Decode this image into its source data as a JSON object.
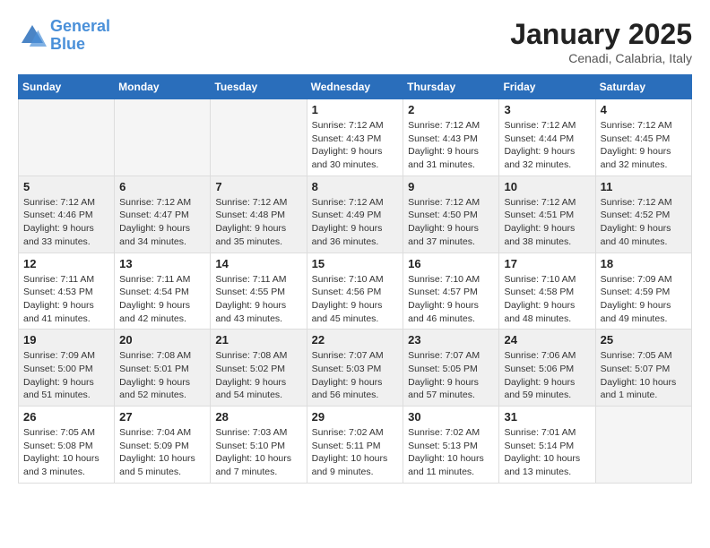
{
  "logo": {
    "name_line1": "General",
    "name_line2": "Blue"
  },
  "header": {
    "month": "January 2025",
    "location": "Cenadi, Calabria, Italy"
  },
  "weekdays": [
    "Sunday",
    "Monday",
    "Tuesday",
    "Wednesday",
    "Thursday",
    "Friday",
    "Saturday"
  ],
  "weeks": [
    {
      "shaded": false,
      "days": [
        {
          "num": "",
          "info": ""
        },
        {
          "num": "",
          "info": ""
        },
        {
          "num": "",
          "info": ""
        },
        {
          "num": "1",
          "info": "Sunrise: 7:12 AM\nSunset: 4:43 PM\nDaylight: 9 hours\nand 30 minutes."
        },
        {
          "num": "2",
          "info": "Sunrise: 7:12 AM\nSunset: 4:43 PM\nDaylight: 9 hours\nand 31 minutes."
        },
        {
          "num": "3",
          "info": "Sunrise: 7:12 AM\nSunset: 4:44 PM\nDaylight: 9 hours\nand 32 minutes."
        },
        {
          "num": "4",
          "info": "Sunrise: 7:12 AM\nSunset: 4:45 PM\nDaylight: 9 hours\nand 32 minutes."
        }
      ]
    },
    {
      "shaded": true,
      "days": [
        {
          "num": "5",
          "info": "Sunrise: 7:12 AM\nSunset: 4:46 PM\nDaylight: 9 hours\nand 33 minutes."
        },
        {
          "num": "6",
          "info": "Sunrise: 7:12 AM\nSunset: 4:47 PM\nDaylight: 9 hours\nand 34 minutes."
        },
        {
          "num": "7",
          "info": "Sunrise: 7:12 AM\nSunset: 4:48 PM\nDaylight: 9 hours\nand 35 minutes."
        },
        {
          "num": "8",
          "info": "Sunrise: 7:12 AM\nSunset: 4:49 PM\nDaylight: 9 hours\nand 36 minutes."
        },
        {
          "num": "9",
          "info": "Sunrise: 7:12 AM\nSunset: 4:50 PM\nDaylight: 9 hours\nand 37 minutes."
        },
        {
          "num": "10",
          "info": "Sunrise: 7:12 AM\nSunset: 4:51 PM\nDaylight: 9 hours\nand 38 minutes."
        },
        {
          "num": "11",
          "info": "Sunrise: 7:12 AM\nSunset: 4:52 PM\nDaylight: 9 hours\nand 40 minutes."
        }
      ]
    },
    {
      "shaded": false,
      "days": [
        {
          "num": "12",
          "info": "Sunrise: 7:11 AM\nSunset: 4:53 PM\nDaylight: 9 hours\nand 41 minutes."
        },
        {
          "num": "13",
          "info": "Sunrise: 7:11 AM\nSunset: 4:54 PM\nDaylight: 9 hours\nand 42 minutes."
        },
        {
          "num": "14",
          "info": "Sunrise: 7:11 AM\nSunset: 4:55 PM\nDaylight: 9 hours\nand 43 minutes."
        },
        {
          "num": "15",
          "info": "Sunrise: 7:10 AM\nSunset: 4:56 PM\nDaylight: 9 hours\nand 45 minutes."
        },
        {
          "num": "16",
          "info": "Sunrise: 7:10 AM\nSunset: 4:57 PM\nDaylight: 9 hours\nand 46 minutes."
        },
        {
          "num": "17",
          "info": "Sunrise: 7:10 AM\nSunset: 4:58 PM\nDaylight: 9 hours\nand 48 minutes."
        },
        {
          "num": "18",
          "info": "Sunrise: 7:09 AM\nSunset: 4:59 PM\nDaylight: 9 hours\nand 49 minutes."
        }
      ]
    },
    {
      "shaded": true,
      "days": [
        {
          "num": "19",
          "info": "Sunrise: 7:09 AM\nSunset: 5:00 PM\nDaylight: 9 hours\nand 51 minutes."
        },
        {
          "num": "20",
          "info": "Sunrise: 7:08 AM\nSunset: 5:01 PM\nDaylight: 9 hours\nand 52 minutes."
        },
        {
          "num": "21",
          "info": "Sunrise: 7:08 AM\nSunset: 5:02 PM\nDaylight: 9 hours\nand 54 minutes."
        },
        {
          "num": "22",
          "info": "Sunrise: 7:07 AM\nSunset: 5:03 PM\nDaylight: 9 hours\nand 56 minutes."
        },
        {
          "num": "23",
          "info": "Sunrise: 7:07 AM\nSunset: 5:05 PM\nDaylight: 9 hours\nand 57 minutes."
        },
        {
          "num": "24",
          "info": "Sunrise: 7:06 AM\nSunset: 5:06 PM\nDaylight: 9 hours\nand 59 minutes."
        },
        {
          "num": "25",
          "info": "Sunrise: 7:05 AM\nSunset: 5:07 PM\nDaylight: 10 hours\nand 1 minute."
        }
      ]
    },
    {
      "shaded": false,
      "days": [
        {
          "num": "26",
          "info": "Sunrise: 7:05 AM\nSunset: 5:08 PM\nDaylight: 10 hours\nand 3 minutes."
        },
        {
          "num": "27",
          "info": "Sunrise: 7:04 AM\nSunset: 5:09 PM\nDaylight: 10 hours\nand 5 minutes."
        },
        {
          "num": "28",
          "info": "Sunrise: 7:03 AM\nSunset: 5:10 PM\nDaylight: 10 hours\nand 7 minutes."
        },
        {
          "num": "29",
          "info": "Sunrise: 7:02 AM\nSunset: 5:11 PM\nDaylight: 10 hours\nand 9 minutes."
        },
        {
          "num": "30",
          "info": "Sunrise: 7:02 AM\nSunset: 5:13 PM\nDaylight: 10 hours\nand 11 minutes."
        },
        {
          "num": "31",
          "info": "Sunrise: 7:01 AM\nSunset: 5:14 PM\nDaylight: 10 hours\nand 13 minutes."
        },
        {
          "num": "",
          "info": ""
        }
      ]
    }
  ]
}
